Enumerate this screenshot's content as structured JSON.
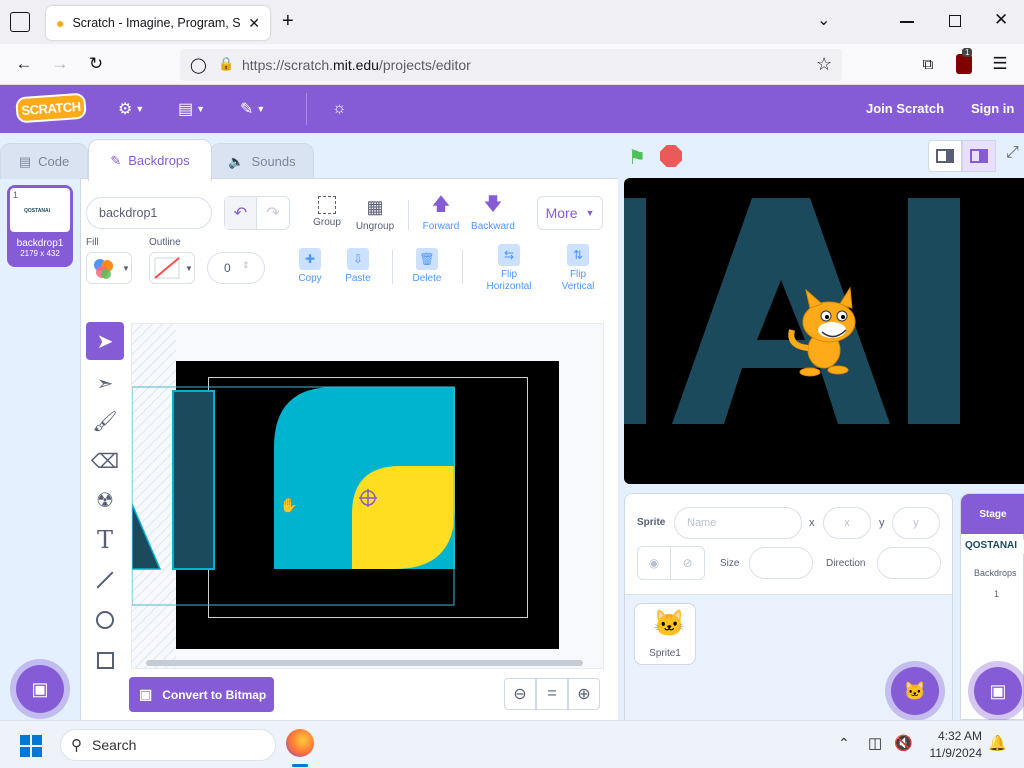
{
  "browser": {
    "tab_title": "Scratch - Imagine, Program, Sh",
    "url_prefix": "https://scratch.",
    "url_domain": "mit.edu",
    "url_path": "/projects/editor",
    "extension_badge": "1"
  },
  "menu": {
    "logo": "SCRATCH",
    "join": "Join Scratch",
    "signin": "Sign in"
  },
  "editor_tabs": [
    {
      "label": "Code",
      "icon": "code-icon"
    },
    {
      "label": "Backdrops",
      "icon": "brush-icon"
    },
    {
      "label": "Sounds",
      "icon": "speaker-icon"
    }
  ],
  "costume": {
    "index": "1",
    "name": "backdrop1",
    "size": "2179 x 432",
    "thumb_text": "QOSTANAI"
  },
  "paint": {
    "name_value": "backdrop1",
    "fill_label": "Fill",
    "outline_label": "Outline",
    "outline_width": "0",
    "group": "Group",
    "ungroup": "Ungroup",
    "forward": "Forward",
    "backward": "Backward",
    "more": "More",
    "copy": "Copy",
    "paste": "Paste",
    "delete": "Delete",
    "flip_h": "Flip Horizontal",
    "flip_v": "Flip Vertical",
    "convert": "Convert to Bitmap",
    "zoom_reset": "="
  },
  "sprite_info": {
    "sprite_label": "Sprite",
    "name_placeholder": "Name",
    "x_label": "x",
    "x_placeholder": "x",
    "y_label": "y",
    "y_placeholder": "y",
    "size_label": "Size",
    "direction_label": "Direction"
  },
  "sprites": [
    {
      "name": "Sprite1"
    }
  ],
  "stage_panel": {
    "title": "Stage",
    "thumb_text": "QOSTANAI",
    "backdrops_label": "Backdrops",
    "backdrops_count": "1"
  },
  "taskbar": {
    "search": "Search",
    "time": "4:32 AM",
    "date": "11/9/2024"
  },
  "colors": {
    "scratch_purple": "#855cd6",
    "shape_cyan": "#00b4cf",
    "shape_yellow": "#ffde21",
    "text_dark_teal": "#1b4a5c"
  }
}
